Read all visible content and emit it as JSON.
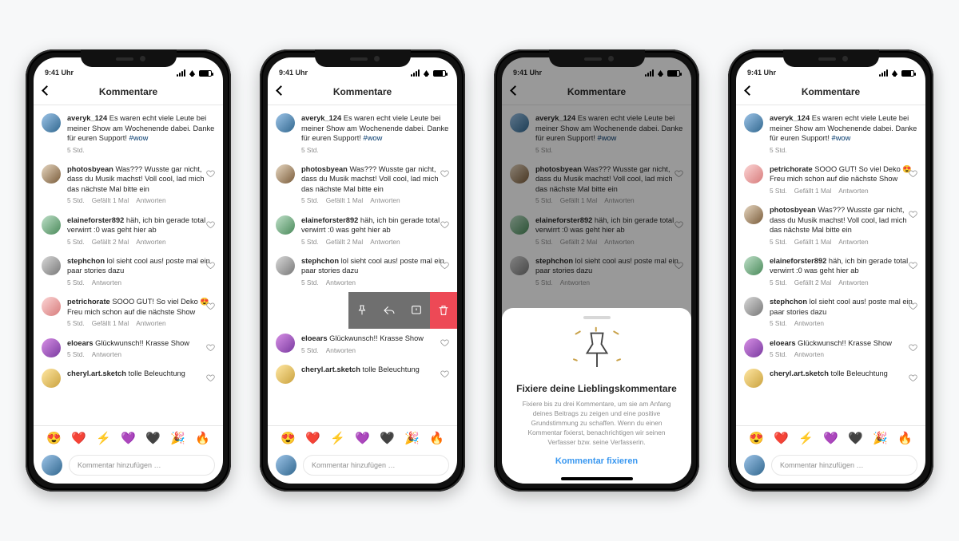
{
  "status": {
    "time": "9:41 Uhr"
  },
  "nav": {
    "title": "Kommentare"
  },
  "compose": {
    "placeholder": "Kommentar hinzufügen …"
  },
  "emoji": [
    "😍",
    "❤️",
    "⚡",
    "💜",
    "🖤",
    "🎉",
    "🔥"
  ],
  "sheet": {
    "title": "Fixiere deine Lieblingskommentare",
    "body": "Fixiere bis zu drei Kommentare, um sie am Anfang deines Beitrags zu zeigen und eine positive Grundstimmung zu schaffen. Wenn du einen Kommentar fixierst, benachrichtigen wir seinen Verfasser bzw. seine Verfasserin.",
    "cta": "Kommentar fixieren"
  },
  "swipe_snippet": {
    "line1": "viel Deko 😍",
    "line2": "ste Show"
  },
  "comments": {
    "avery": {
      "u": "averyk_124",
      "t": "Es waren echt viele Leute bei meiner Show am Wochenende dabei. Danke für euren Support! ",
      "hash": "#wow",
      "m": [
        "5 Std."
      ]
    },
    "photos": {
      "u": "photosbyean",
      "t": "Was??? Wusste gar nicht, dass du Musik machst! Voll cool, lad mich das nächste Mal bitte ein",
      "m": [
        "5 Std.",
        "Gefällt 1 Mal",
        "Antworten"
      ]
    },
    "elaine": {
      "u": "elaineforster892",
      "t": "häh, ich bin gerade total verwirrt :0 was geht hier ab",
      "m": [
        "5 Std.",
        "Gefällt 2 Mal",
        "Antworten"
      ]
    },
    "steph": {
      "u": "stephchon",
      "t": "lol sieht cool aus! poste mal ein paar stories dazu",
      "m": [
        "5 Std.",
        "Antworten"
      ]
    },
    "petri": {
      "u": "petrichorate",
      "t": "SOOO GUT! So viel Deko 😍 Freu mich schon auf die nächste Show",
      "m": [
        "5 Std.",
        "Gefällt 1 Mal",
        "Antworten"
      ]
    },
    "eloe": {
      "u": "eloears",
      "t": "Glückwunsch!! Krasse Show",
      "m": [
        "5 Std.",
        "Antworten"
      ]
    },
    "cheryl": {
      "u": "cheryl.art.sketch",
      "t": "tolle Beleuchtung",
      "m": []
    }
  },
  "order": {
    "p1": [
      "avery",
      "photos",
      "elaine",
      "steph",
      "petri",
      "eloe",
      "cheryl"
    ],
    "p4": [
      "avery",
      "petri",
      "photos",
      "elaine",
      "steph",
      "eloe",
      "cheryl"
    ]
  },
  "avatar_class": {
    "avery": "p1",
    "photos": "p2",
    "elaine": "p3",
    "steph": "p4",
    "petri": "p5",
    "eloe": "p6",
    "cheryl": "p7"
  }
}
